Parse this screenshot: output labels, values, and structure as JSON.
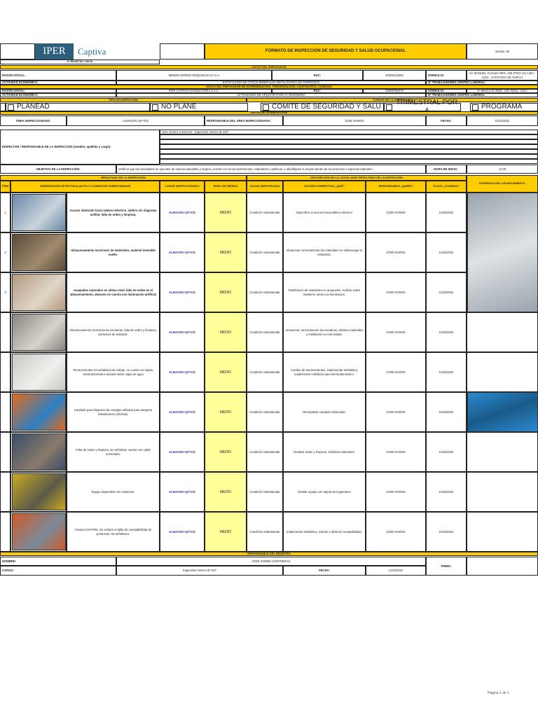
{
  "header": {
    "title": "FORMATO DE INSPECCIÓN DE SEGURIDAD Y SALUD OCUPACIONAL",
    "version": "Versión: 00",
    "registro": "Nº REGISTRO: 008-08",
    "logo_text": "IPER",
    "logo_text2": "Captiva"
  },
  "employer": {
    "section": "DATOS DEL EMPLEADOR",
    "razon_label": "RAZON SOCIAL:",
    "razon": "MINERA BORDO MOQUECHILCA S.A",
    "ruc_label": "RUC:",
    "ruc": "20209133394",
    "domicilio_label": "DOMICILIO:",
    "domicilio": "AV. MANUEL OLGUIN NRO. 325 (PISO 12) LIMA - LIMA - SANTIAGO DE SURCO",
    "actividad_label": "ACTIVIDAD ECONÓMICA:",
    "actividad": "EXTRACCIÓN DE OTROS MINERALES METALÍFEROS NO FERROSOS",
    "trabajadores_label": "Nº TRABAJADORES CENTRO LABORAL:"
  },
  "intermediary": {
    "section": "DATOS DEL EMPLEADOR DE INTERMEDIACIÓN, TERCERIZACIÓN, CONTRATISTA, CONEXAS",
    "razon_label": "RAZON SOCIAL:",
    "razon": "IPER CAPTIVA CONSULTORIA S.A.C.",
    "ruc_label": "RUC:",
    "ruc": "20608756475",
    "domicilio_label": "DOMICILIO:",
    "domicilio": "Jr. Mexico Nº 2620 - Urb. Rosa - Lince",
    "actividad_label": "ACTIVIDAD ECONÓMICA:",
    "actividad": "ACTIVIDADES DE ARQUITECTURA E INGENIERIA",
    "trabajadores_label": "Nº TRABAJADORES CENTRO LABORAL"
  },
  "tipo": {
    "label": "TIPO DE INSPECCIÓN",
    "fuente_label": "FUENTE DE LA INSPECCIÓN",
    "opts": [
      "PLANEAD",
      "NO PLANE",
      "COMITE DE SEGURIDAD Y SALU",
      "TRIMESTRAL POR A",
      "PROGRAMA"
    ]
  },
  "inspeccion": {
    "section": "DATOS DE LA INSPECCIÓN",
    "area_label": "ÁREA INSPECCIONADO:",
    "area": "ALMACÉN VyP ICE",
    "resp_label": "RESPONSABLE DEL ÁREA INSPECCIONADA:",
    "resp": "JOSE RAMOS",
    "fecha_label": "FECHA:",
    "fecha": "11/22/2022",
    "inspector_label": "INSPECTOR / RESPONSABLE DE LA INSPECCIÓN (nombre, apellido y cargo):",
    "inspector": "Jose Gomez Contreras - Supervisor Senior de SST",
    "objetivo_label": "OBJETIVO DE LA INSPECCIÓN:",
    "objetivo": "Verificar que las actividades se ejecuten de manera saludable y segura, acorde con los procedimientos, estándares y políticas, e identifiquen la mejora dentro de los procesos o espacios laborales.",
    "hora_label": "HORA DE INICIO :",
    "hora": "11:00"
  },
  "table": {
    "resultado": "RESULTADO DE LA INSPECCIÓN",
    "descripcion": "DESCRIPCIÓN DE LA CAUSA ANTE RESULTADO DE LA INSPECCIÓN",
    "evidencia": "EVIDENCIA DEL LEVANTAMIENTO",
    "cols": [
      "ÍTEM",
      "OBSERVACIÓN DETECTADA (ACTO O CONDICIÓN SUBESTANDAR)",
      "LUGAR INSPECCIONADO",
      "NIVEL DE RIESGO",
      "CAUSA IDENTIFICADA",
      "ACCIÓN CORRECTIVA ¿QUÉ?",
      "RESPONSABLE ¿QUIÉN?",
      "PLAZO ¿CUÁNDO?"
    ],
    "rows": [
      {
        "item": "1",
        "obs": "Acceso obstruido hacia tablero eléctrico, tablero sin diagrama unifilar, falta de orden y limpieza,",
        "bold": true,
        "lugar": "ALMACEN VyP ICE",
        "nivel": "MEDIO",
        "causa": "Condición Subestandar",
        "accion": "Dejar libre el acceso hacia tablero electrico",
        "resp": "JOSE RAMOS",
        "plazo": "11/25/2022"
      },
      {
        "item": "2",
        "obs": "Almacenamiento incorrecto de materiales, material inestable suelto.",
        "bold": true,
        "lugar": "ALMACEN VyP ICE",
        "nivel": "MEDIO",
        "causa": "Condición Subestandar",
        "accion": "Almacenar correctamente los materiales no sobrecargar la estanteria.",
        "resp": "JOSE RAMOS",
        "plazo": "11/25/2022"
      },
      {
        "item": "3",
        "obs": "Anaqueles saturados en ultimo nivel, falta de orden en el almacenamiento, almacen no cuenta con iluminacion artificial",
        "bold": true,
        "lugar": "ALMACEN VyP ICE",
        "nivel": "MEDIO",
        "causa": "Condición Subestandar",
        "accion": "Distribucion de materiales en anaqueles, realizar orden mantener areas con iluminacion.",
        "resp": "JOSE RAMOS",
        "plazo": "11/25/2022"
      },
      {
        "item": "",
        "obs": "Almacenamiento incorrecto de escaleras, falta de orden y limpieza, presencia de residuos.",
        "bold": false,
        "lugar": "ALMACEN VyP ICE",
        "nivel": "MEDIO",
        "causa": "Condición Subestandar",
        "accion": "Almacenar correctamente las escaleras, eliminar materiales y mobiliarios en mal estado.",
        "resp": "JOSE RAMOS",
        "plazo": "11/25/2022"
      },
      {
        "item": "",
        "obs": "Tomacorrientes sin señaletica de voltaje, no cuenta con tapas, electrodomestico ubicado sobre cajas de agua",
        "bold": false,
        "lugar": "ALMACEN VyP ICE",
        "nivel": "MEDIO",
        "causa": "Condición Subestandar",
        "accion": "Cambio de tomacorrientes, implementar señaletica, implementar mobiliario para electrodomestico.",
        "resp": "JOSE RAMOS",
        "plazo": "11/25/2022"
      },
      {
        "item": "",
        "obs": "Candado para bloqueos de energias utilizado para asegurar instalaciones (oficinas).",
        "bold": false,
        "lugar": "ALMACEN VyP ICE",
        "nivel": "MEDIO",
        "causa": "Condición Subestandar",
        "accion": "Reemplazar candado observado.",
        "resp": "JOSE RAMOS",
        "plazo": "11/25/2022"
      },
      {
        "item": "",
        "obs": "Falta de orden y limpieza, sin señalizar, carrete con cable enmedado.",
        "bold": false,
        "lugar": "ALMACEN VyP ICE",
        "nivel": "MEDIO",
        "causa": "Condición Subestandar",
        "accion": "Realizar orden y limpieza, señalizar materiales,",
        "resp": "JOSE RAMOS",
        "plazo": "11/25/2022"
      },
      {
        "item": "",
        "obs": "Equipo inoperativo sin rotulacion.",
        "bold": false,
        "lugar": "ALMACEN VyP ICE",
        "nivel": "MEDIO",
        "causa": "Condición Subestandar",
        "accion": "Rotular equipo con tarjeta de inoperativo",
        "resp": "JOSE RAMOS",
        "plazo": "11/25/2022"
      },
      {
        "item": "",
        "obs": "Almacen MATPEL sin extintor ni tabla de compatibilidad de productos, sin señaletica.",
        "bold": false,
        "lugar": "ALMACEN VyP ICE",
        "nivel": "MEDIO",
        "causa": "Condicion subestandar",
        "accion": "Implementar señaletica, extintor y tabla de compatibilidad.",
        "resp": "JOSE RAMOS",
        "plazo": "10/25/2022"
      }
    ]
  },
  "registro": {
    "section": "RESPONSABLE DEL REGISTRO",
    "nombre_label": "NOMBRE:",
    "nombre": "JOSE GOMEZ CONTRERAS",
    "cargo_label": "CARGO:",
    "cargo": "Supervisor Senior de SST",
    "fecha_label": "FECHA:",
    "fecha": "11/22/2022",
    "firma_label": "FIRMA:"
  },
  "footer": "Página 1 de 1",
  "colors": {
    "accent": "#ffcc00",
    "risk": "#ffff99"
  }
}
